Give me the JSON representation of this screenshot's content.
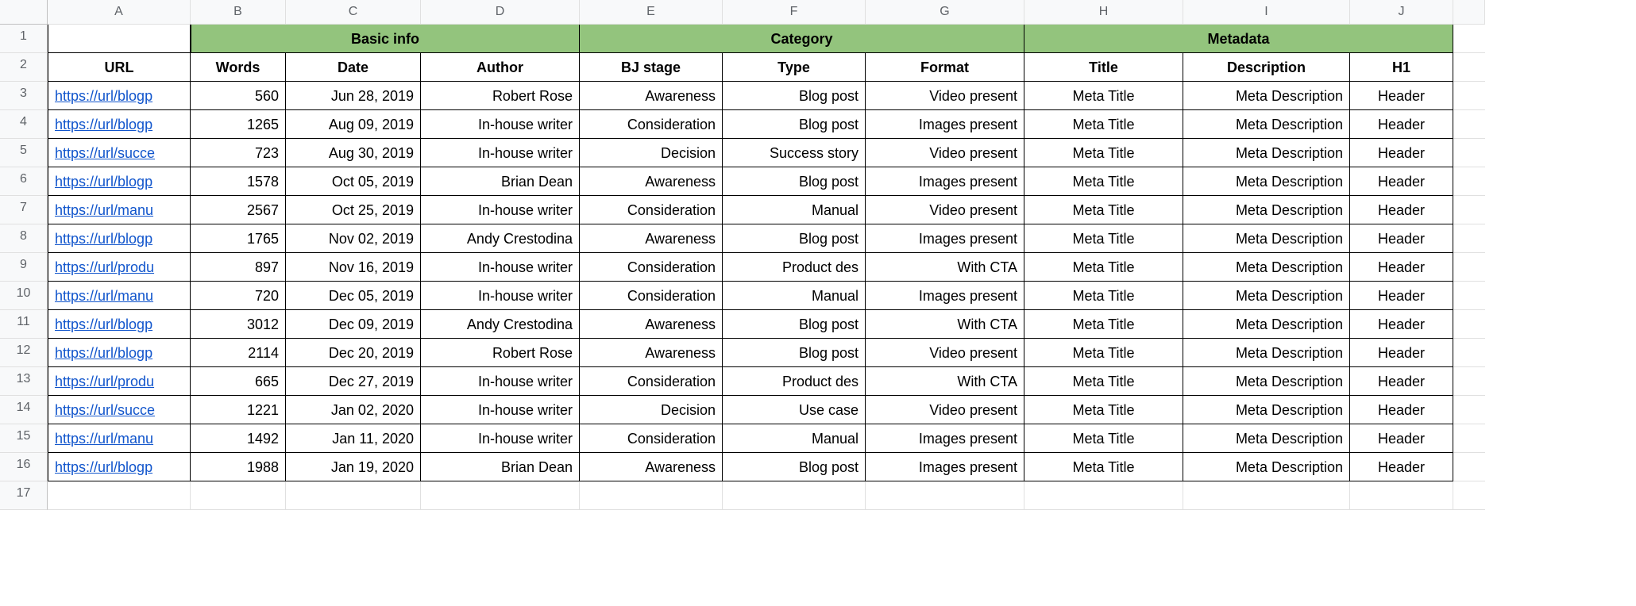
{
  "columns": [
    "A",
    "B",
    "C",
    "D",
    "E",
    "F",
    "G",
    "H",
    "I",
    "J"
  ],
  "row_numbers": [
    "1",
    "2",
    "3",
    "4",
    "5",
    "6",
    "7",
    "8",
    "9",
    "10",
    "11",
    "12",
    "13",
    "14",
    "15",
    "16",
    "17"
  ],
  "groups": {
    "basic_info": "Basic info",
    "category": "Category",
    "metadata": "Metadata"
  },
  "headers": {
    "url": "URL",
    "words": "Words",
    "date": "Date",
    "author": "Author",
    "bj_stage": "BJ stage",
    "type": "Type",
    "format": "Format",
    "title": "Title",
    "description": "Description",
    "h1": "H1"
  },
  "rows": [
    {
      "url": "https://url/blogp",
      "words": "560",
      "date": "Jun 28, 2019",
      "author": "Robert Rose",
      "bj": "Awareness",
      "type": "Blog post",
      "format": "Video present",
      "title": "Meta Title",
      "desc": "Meta Description",
      "h1": "Header"
    },
    {
      "url": "https://url/blogp",
      "words": "1265",
      "date": "Aug 09, 2019",
      "author": "In-house writer",
      "bj": "Consideration",
      "type": "Blog post",
      "format": "Images present",
      "title": "Meta Title",
      "desc": "Meta Description",
      "h1": "Header"
    },
    {
      "url": "https://url/succe",
      "words": "723",
      "date": "Aug 30, 2019",
      "author": "In-house writer",
      "bj": "Decision",
      "type": "Success story",
      "format": "Video present",
      "title": "Meta Title",
      "desc": "Meta Description",
      "h1": "Header"
    },
    {
      "url": "https://url/blogp",
      "words": "1578",
      "date": "Oct 05, 2019",
      "author": "Brian Dean",
      "bj": "Awareness",
      "type": "Blog post",
      "format": "Images present",
      "title": "Meta Title",
      "desc": "Meta Description",
      "h1": "Header"
    },
    {
      "url": "https://url/manu",
      "words": "2567",
      "date": "Oct 25, 2019",
      "author": "In-house writer",
      "bj": "Consideration",
      "type": "Manual",
      "format": "Video present",
      "title": "Meta Title",
      "desc": "Meta Description",
      "h1": "Header"
    },
    {
      "url": "https://url/blogp",
      "words": "1765",
      "date": "Nov 02, 2019",
      "author": "Andy Crestodina",
      "bj": "Awareness",
      "type": "Blog post",
      "format": "Images present",
      "title": "Meta Title",
      "desc": "Meta Description",
      "h1": "Header"
    },
    {
      "url": "https://url/produ",
      "words": "897",
      "date": "Nov 16, 2019",
      "author": "In-house writer",
      "bj": "Consideration",
      "type": "Product des",
      "format": "With CTA",
      "title": "Meta Title",
      "desc": "Meta Description",
      "h1": "Header"
    },
    {
      "url": "https://url/manu",
      "words": "720",
      "date": "Dec 05, 2019",
      "author": "In-house writer",
      "bj": "Consideration",
      "type": "Manual",
      "format": "Images present",
      "title": "Meta Title",
      "desc": "Meta Description",
      "h1": "Header"
    },
    {
      "url": "https://url/blogp",
      "words": "3012",
      "date": "Dec 09, 2019",
      "author": "Andy Crestodina",
      "bj": "Awareness",
      "type": "Blog post",
      "format": "With CTA",
      "title": "Meta Title",
      "desc": "Meta Description",
      "h1": "Header"
    },
    {
      "url": "https://url/blogp",
      "words": "2114",
      "date": "Dec 20, 2019",
      "author": "Robert Rose",
      "bj": "Awareness",
      "type": "Blog post",
      "format": "Video present",
      "title": "Meta Title",
      "desc": "Meta Description",
      "h1": "Header"
    },
    {
      "url": "https://url/produ",
      "words": "665",
      "date": "Dec 27, 2019",
      "author": "In-house writer",
      "bj": "Consideration",
      "type": "Product des",
      "format": "With CTA",
      "title": "Meta Title",
      "desc": "Meta Description",
      "h1": "Header"
    },
    {
      "url": "https://url/succe",
      "words": "1221",
      "date": "Jan 02, 2020",
      "author": "In-house writer",
      "bj": "Decision",
      "type": "Use case",
      "format": "Video present",
      "title": "Meta Title",
      "desc": "Meta Description",
      "h1": "Header"
    },
    {
      "url": "https://url/manu",
      "words": "1492",
      "date": "Jan 11, 2020",
      "author": "In-house writer",
      "bj": "Consideration",
      "type": "Manual",
      "format": "Images present",
      "title": "Meta Title",
      "desc": "Meta Description",
      "h1": "Header"
    },
    {
      "url": "https://url/blogp",
      "words": "1988",
      "date": "Jan 19, 2020",
      "author": "Brian Dean",
      "bj": "Awareness",
      "type": "Blog post",
      "format": "Images present",
      "title": "Meta Title",
      "desc": "Meta Description",
      "h1": "Header"
    }
  ]
}
